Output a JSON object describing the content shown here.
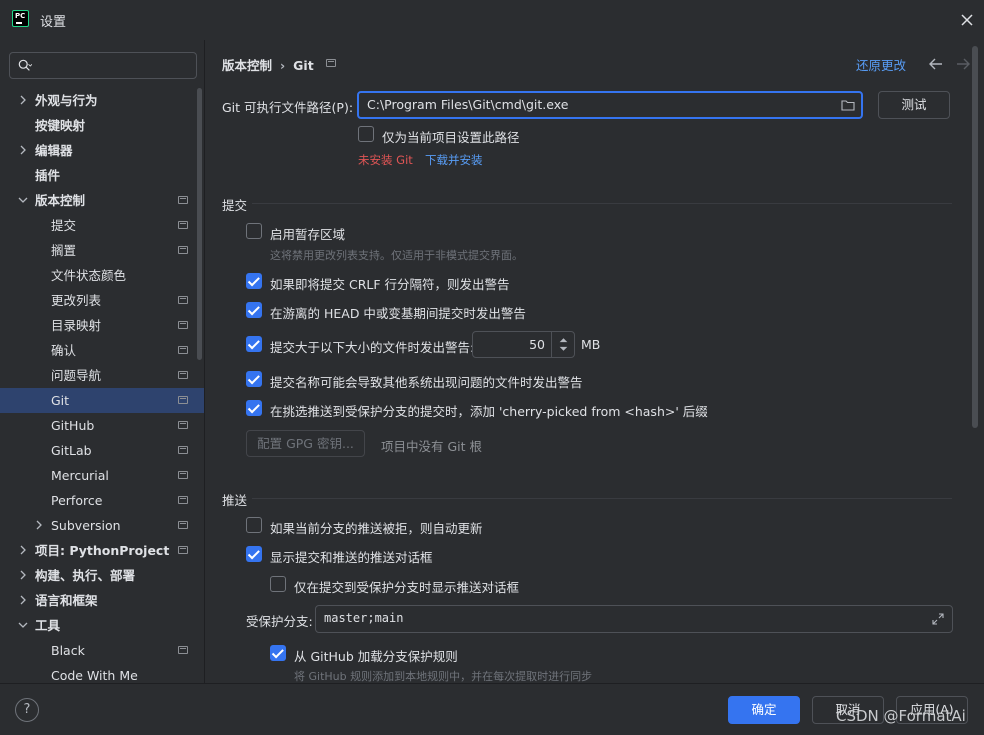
{
  "window": {
    "title": "设置",
    "logo_text": "PC"
  },
  "sidebar": {
    "search_placeholder": "",
    "items": [
      {
        "label": "外观与行为",
        "bold": true,
        "expandable": true,
        "expanded": false,
        "level": 0,
        "project": false
      },
      {
        "label": "按键映射",
        "bold": true,
        "expandable": false,
        "level": 0,
        "project": false
      },
      {
        "label": "编辑器",
        "bold": true,
        "expandable": true,
        "expanded": false,
        "level": 0,
        "project": false
      },
      {
        "label": "插件",
        "bold": true,
        "expandable": false,
        "level": 0,
        "project": false
      },
      {
        "label": "版本控制",
        "bold": true,
        "expandable": true,
        "expanded": true,
        "level": 0,
        "project": true
      },
      {
        "label": "提交",
        "level": 1,
        "project": true
      },
      {
        "label": "搁置",
        "level": 1,
        "project": true
      },
      {
        "label": "文件状态颜色",
        "level": 1,
        "project": false
      },
      {
        "label": "更改列表",
        "level": 1,
        "project": true
      },
      {
        "label": "目录映射",
        "level": 1,
        "project": true
      },
      {
        "label": "确认",
        "level": 1,
        "project": true
      },
      {
        "label": "问题导航",
        "level": 1,
        "project": true
      },
      {
        "label": "Git",
        "level": 1,
        "project": true,
        "selected": true
      },
      {
        "label": "GitHub",
        "level": 1,
        "project": true
      },
      {
        "label": "GitLab",
        "level": 1,
        "project": true
      },
      {
        "label": "Mercurial",
        "level": 1,
        "project": true
      },
      {
        "label": "Perforce",
        "level": 1,
        "project": true
      },
      {
        "label": "Subversion",
        "level": 1,
        "expandable": true,
        "expanded": false,
        "project": true
      },
      {
        "label": "项目: PythonProject",
        "bold": true,
        "expandable": true,
        "expanded": false,
        "level": 0,
        "project": true
      },
      {
        "label": "构建、执行、部署",
        "bold": true,
        "expandable": true,
        "expanded": false,
        "level": 0,
        "project": false
      },
      {
        "label": "语言和框架",
        "bold": true,
        "expandable": true,
        "expanded": false,
        "level": 0,
        "project": false
      },
      {
        "label": "工具",
        "bold": true,
        "expandable": true,
        "expanded": true,
        "level": 0,
        "project": false
      },
      {
        "label": "Black",
        "level": 1,
        "project": true
      },
      {
        "label": "Code With Me",
        "level": 1,
        "project": false
      }
    ]
  },
  "header": {
    "breadcrumb": [
      "版本控制",
      "Git"
    ],
    "breadcrumb_sep": "›",
    "reset_label": "还原更改"
  },
  "git_path": {
    "label": "Git 可执行文件路径(P):",
    "value": "C:\\Program Files\\Git\\cmd\\git.exe",
    "test_label": "测试",
    "project_only_label": "仅为当前项目设置此路径",
    "project_only_checked": false,
    "not_installed": "未安装 Git",
    "download_link": "下载并安装"
  },
  "commit": {
    "title": "提交",
    "staging_label": "启用暂存区域",
    "staging_checked": false,
    "staging_hint": "这将禁用更改列表支持。仅适用于非模式提交界面。",
    "crlf_label": "如果即将提交 CRLF 行分隔符，则发出警告",
    "crlf_checked": true,
    "detached_label": "在游离的 HEAD 中或变基期间提交时发出警告",
    "detached_checked": true,
    "size_label": "提交大于以下大小的文件时发出警告:",
    "size_checked": true,
    "size_value": "50",
    "size_unit": "MB",
    "names_label": "提交名称可能会导致其他系统出现问题的文件时发出警告",
    "names_checked": true,
    "cherry_label": "在挑选推送到受保护分支的提交时，添加 'cherry-picked from <hash>' 后缀",
    "cherry_checked": true,
    "gpg_button": "配置 GPG 密钥...",
    "no_git_root": "项目中没有 Git 根"
  },
  "push": {
    "title": "推送",
    "auto_update_label": "如果当前分支的推送被拒，则自动更新",
    "auto_update_checked": false,
    "show_dialog_label": "显示提交和推送的推送对话框",
    "show_dialog_checked": true,
    "protected_only_label": "仅在提交到受保护分支时显示推送对话框",
    "protected_only_checked": false,
    "protected_branches_label": "受保护分支:",
    "protected_branches_value": "master;main",
    "github_rules_label": "从 GitHub 加载分支保护规则",
    "github_rules_checked": true,
    "github_rules_hint": "将 GitHub 规则添加到本地规则中，并在每次提取时进行同步"
  },
  "footer": {
    "help": "?",
    "ok": "确定",
    "cancel": "取消",
    "apply": "应用(A)",
    "watermark": "CSDN @FormatAi"
  },
  "colors": {
    "accent": "#3574f0",
    "link": "#589df6",
    "error": "#e05555",
    "selection": "#2e436e"
  },
  "icons": [
    "search-icon",
    "close-icon",
    "folder-icon",
    "chevron-right-icon",
    "chevron-down-icon",
    "project-scope-icon",
    "back-arrow-icon",
    "forward-arrow-icon",
    "expand-icon",
    "help-icon"
  ]
}
